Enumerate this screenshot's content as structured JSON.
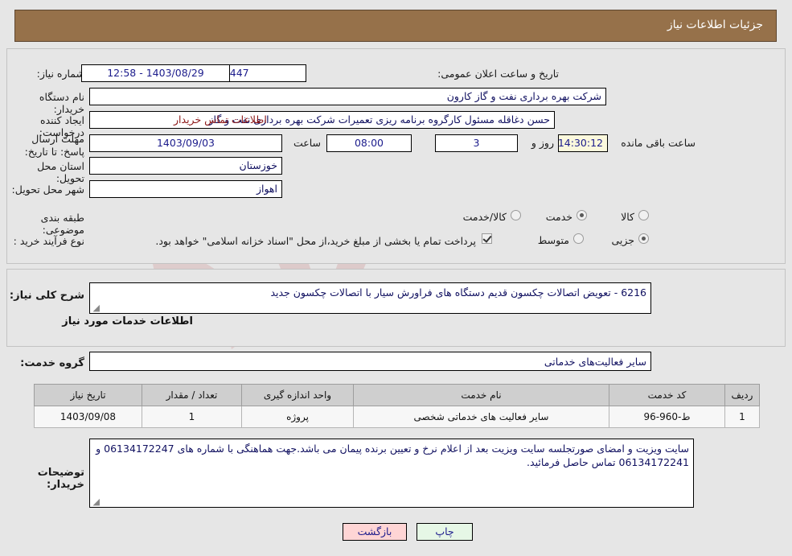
{
  "header": {
    "title": "جزئیات اطلاعات نیاز",
    "bg_color": "#96714a"
  },
  "form": {
    "need_number": {
      "label": "شماره نیاز:",
      "value": "1103092544002447"
    },
    "announce_datetime": {
      "label": "تاریخ و ساعت اعلان عمومی:",
      "value": "1403/08/29 - 12:58"
    },
    "buyer_org": {
      "label": "نام دستگاه خریدار:",
      "value": "شرکت بهره برداری نفت و گاز کارون"
    },
    "request_creator": {
      "label": "ایجاد کننده درخواست:",
      "value": "حسن دغاقله مسئول کارگروه برنامه ریزی تعمیرات شرکت بهره برداری نفت و گاز",
      "contact_link": "اطلاعات تماس خریدار"
    },
    "deadline": {
      "label": "مهلت ارسال پاسخ: تا تاریخ:",
      "date": "1403/09/03",
      "hour_label": "ساعت",
      "hour": "08:00",
      "days": "3",
      "days_label": "روز و",
      "countdown": "14:30:12",
      "remaining_label": "ساعت باقی مانده"
    },
    "province": {
      "label": "استان محل تحویل:",
      "value": "خوزستان"
    },
    "city": {
      "label": "شهر محل تحویل:",
      "value": "اهواز"
    },
    "category": {
      "label": "طبقه بندی موضوعی:",
      "options": [
        "کالا",
        "خدمت",
        "کالا/خدمت"
      ],
      "selected": "خدمت"
    },
    "purchase_type": {
      "label": "نوع فرآیند خرید :",
      "options": [
        "جزیی",
        "متوسط"
      ],
      "selected": "جزیی",
      "treasury_checkbox_checked": true,
      "treasury_note": "پرداخت تمام یا بخشی از مبلغ خرید،از محل \"اسناد خزانه اسلامی\" خواهد بود."
    },
    "general_description": {
      "label": "شرح کلی نیاز:",
      "value": "6216 - تعویض اتصالات چکسون قدیم دستگاه های فراورش سیار با اتصالات چکسون جدید"
    }
  },
  "services_section": {
    "heading": "اطلاعات خدمات مورد نیاز",
    "service_group": {
      "label": "گروه خدمت:",
      "value": "سایر فعالیت‌های خدماتی"
    },
    "table": {
      "columns": [
        "ردیف",
        "کد خدمت",
        "نام خدمت",
        "واحد اندازه گیری",
        "تعداد / مقدار",
        "تاریخ نیاز"
      ],
      "rows": [
        {
          "row_no": "1",
          "service_code": "ط-960-96",
          "service_name": "سایر فعالیت های خدماتی شخصی",
          "unit": "پروژه",
          "quantity": "1",
          "need_date": "1403/09/08"
        }
      ]
    }
  },
  "buyer_notes": {
    "label": "توضیحات خریدار:",
    "value": "سایت ویزیت و امضای صورتجلسه سایت ویزیت بعد از اعلام نرخ و تعیین برنده پیمان می باشد.جهت هماهنگی با شماره های  06134172247 و 06134172241 تماس حاصل فرمائید."
  },
  "footer": {
    "back_button": "بازگشت",
    "print_button": "چاپ"
  },
  "watermark": {
    "text": "AriaTender.net"
  }
}
